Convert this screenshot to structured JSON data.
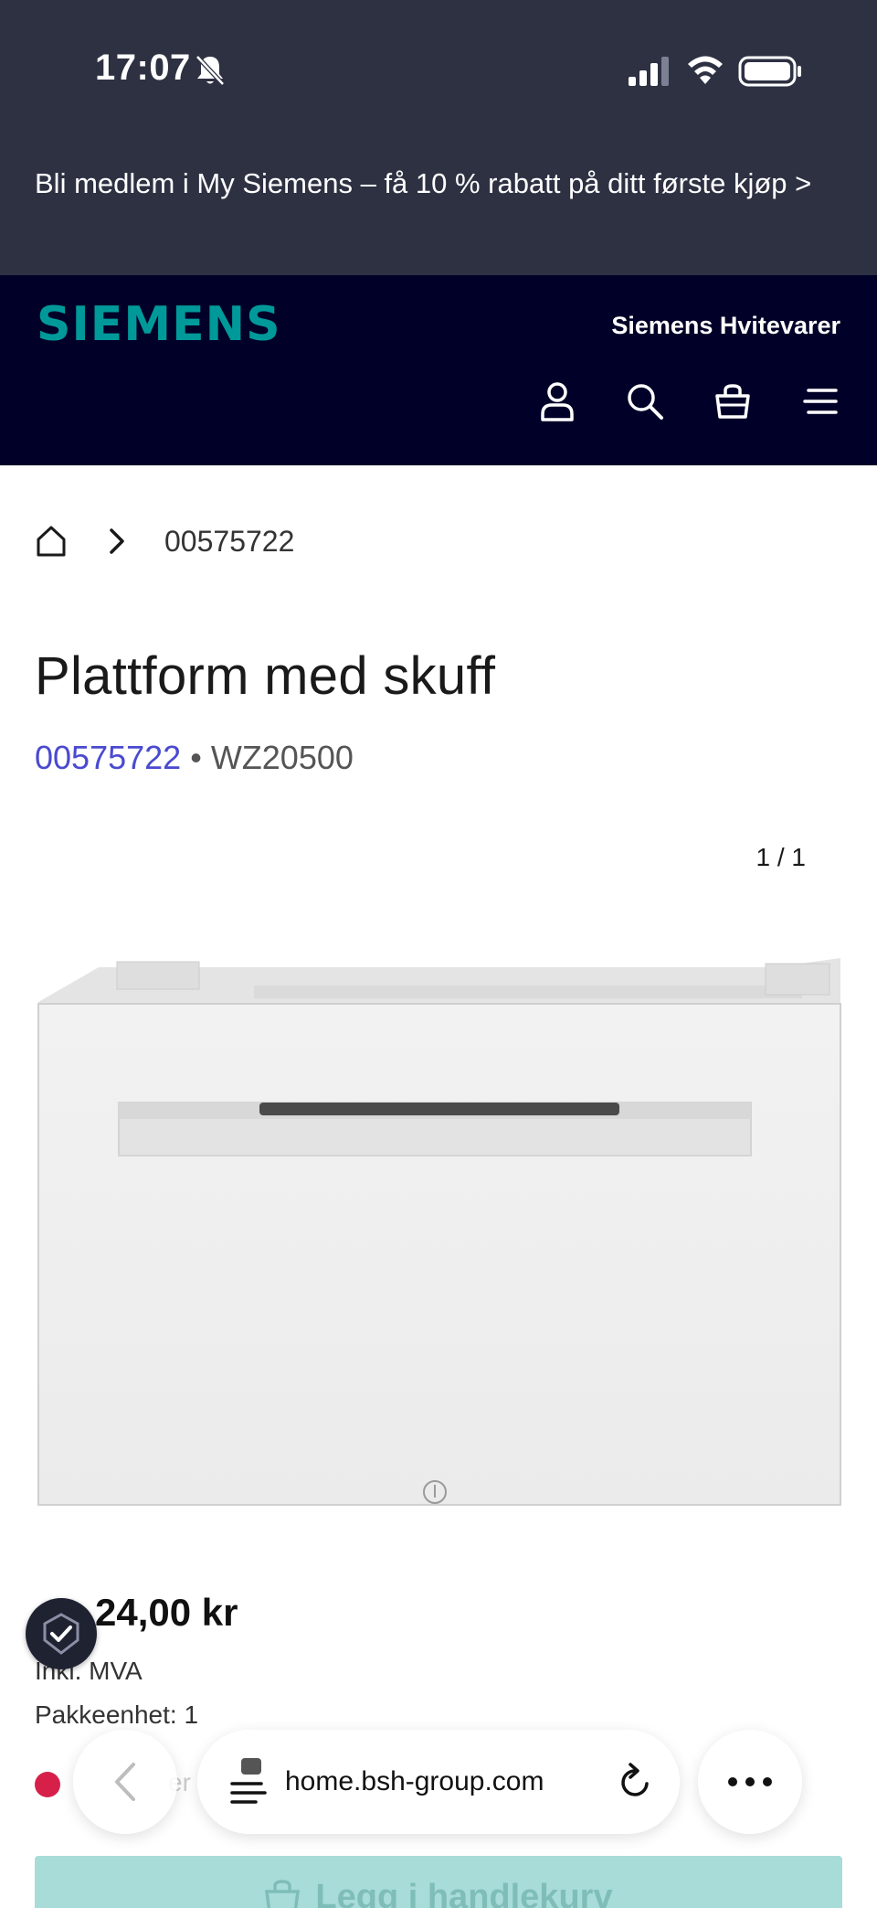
{
  "status_bar": {
    "time": "17:07",
    "icons": [
      "bell-slash-icon",
      "signal-icon",
      "wifi-icon",
      "battery-icon"
    ]
  },
  "promo": {
    "text": "Bli medlem i My Siemens – få 10 % rabatt på ditt første kjøp >"
  },
  "header": {
    "logo": "SIEMENS",
    "tagline": "Siemens Hvitevarer",
    "icons": [
      "user-icon",
      "search-icon",
      "basket-icon",
      "menu-icon"
    ],
    "colors": {
      "background": "#000028",
      "logo": "#009999"
    }
  },
  "breadcrumb": {
    "home_icon": "home-icon",
    "separator_icon": "chevron-right-icon",
    "current": "00575722"
  },
  "product": {
    "title": "Plattform med skuff",
    "part_number": "00575722",
    "separator": "•",
    "model": "WZ20500",
    "gallery_counter": "1 / 1",
    "price_partial": "24,00 kr",
    "vat": "Inkl. MVA",
    "pack_unit": "Pakkeenhet: 1",
    "stock_partial": "er",
    "add_to_cart": "Legg i handlekurv"
  },
  "browser": {
    "url": "home.bsh-group.com",
    "icons": [
      "back-icon",
      "reader-icon",
      "reload-icon",
      "more-icon"
    ]
  }
}
